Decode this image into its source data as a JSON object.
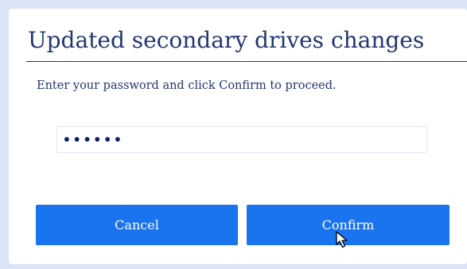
{
  "dialog": {
    "title": "Updated secondary drives changes",
    "instructions": "Enter your password and click Confirm to proceed.",
    "password": {
      "value": "••••••",
      "input_type": "password"
    },
    "buttons": {
      "cancel_label": "Cancel",
      "confirm_label": "Confirm"
    }
  },
  "cursor": {
    "icon": "mouse-pointer-icon"
  },
  "colors": {
    "background": "#dbe3f6",
    "dialog_background": "#ffffff",
    "title_text": "#223671",
    "button_primary": "#1a73ef",
    "button_text": "#ffffff",
    "input_border": "#dde9f5"
  }
}
